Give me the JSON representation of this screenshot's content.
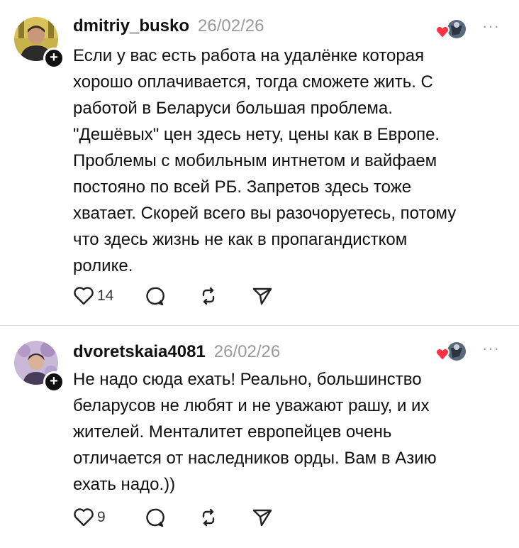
{
  "posts": [
    {
      "username": "dmitriy_busko",
      "date": "26/02/26",
      "text": "Если у вас есть работа на удалёнке которая\nхорошо оплачивается, тогда сможете жить. С\nработой в Беларуси большая проблема.\n\"Дешёвых\" цен здесь нету, цены как в Европе.\nПроблемы с мобильным интнетом и вайфаем\nпостояно по всей РБ. Запретов здесь тоже\nхватает. Скорей всего вы разочоруетесь, потому\nчто здесь жизнь не как в пропагандистком\nролике.",
      "likes": "14",
      "follow_symbol": "+",
      "more_symbol": "···"
    },
    {
      "username": "dvoretskaia4081",
      "date": "26/02/26",
      "text": "Не надо сюда ехать! Реально, большинство\nбеларусов не любят и не уважают рашу, и их\nжителей. Менталитет европейцев очень\nотличается от наследников орды. Вам в Азию\nехать надо.))",
      "likes": "9",
      "follow_symbol": "+",
      "more_symbol": "···"
    }
  ],
  "icons": {
    "like": "heart-outline-icon",
    "reply": "comment-bubble-icon",
    "repost": "repost-arrows-icon",
    "share": "send-icon",
    "liked_badge": "heart-filled-icon"
  },
  "colors": {
    "text": "#111111",
    "muted": "#9a9a9a",
    "liked_heart": "#ff3040",
    "divider": "#dcdcdc"
  }
}
